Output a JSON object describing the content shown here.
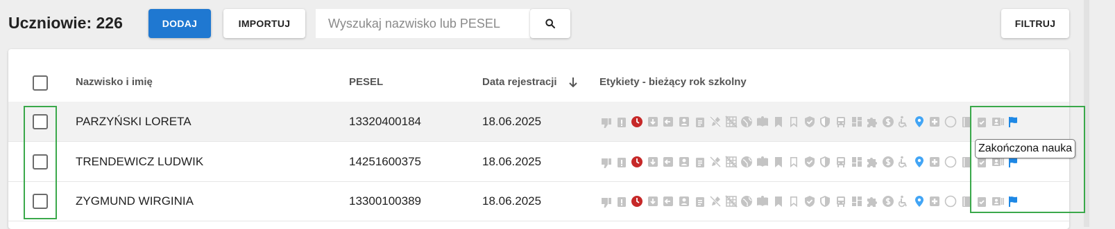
{
  "header": {
    "title": "Uczniowie: 226",
    "add_label": "DODAJ",
    "import_label": "IMPORTUJ",
    "search_placeholder": "Wyszukaj nazwisko lub PESEL",
    "filter_label": "FILTRUJ"
  },
  "table": {
    "columns": {
      "name": "Nazwisko i imię",
      "pesel": "PESEL",
      "date": "Data rejestracji",
      "labels": "Etykiety - bieżący rok szkolny"
    },
    "sort": {
      "column": "date",
      "direction": "desc"
    },
    "rows": [
      {
        "name": "PARZYŃSKI LORETA",
        "pesel": "13320400184",
        "date": "18.06.2025"
      },
      {
        "name": "TRENDEWICZ LUDWIK",
        "pesel": "14251600375",
        "date": "18.06.2025"
      },
      {
        "name": "ZYGMUND WIRGINIA",
        "pesel": "13300100389",
        "date": "18.06.2025"
      }
    ]
  },
  "label_icons": [
    "thumb-down-icon",
    "clipboard-alert-icon",
    "clock-icon",
    "download-box-icon",
    "back-box-icon",
    "account-box-icon",
    "clipboard-text-icon",
    "pen-off-icon",
    "grid-off-icon",
    "globe-icon",
    "book-open-icon",
    "bookmark-icon",
    "bookmark-outline-icon",
    "shield-check-icon",
    "shield-half-icon",
    "bus-icon",
    "view-dashboard-icon",
    "puzzle-icon",
    "dollar-circle-icon",
    "wheelchair-icon",
    "map-marker-icon",
    "plus-box-icon",
    "circle-outline-icon",
    "notebook-icon",
    "clipboard-check-icon",
    "contact-card-icon",
    "flag-icon"
  ],
  "tooltip": "Zakończona nauka",
  "colors": {
    "primary": "#1f78d1",
    "icon_gray": "#c4c4c4",
    "clock_red": "#c62828",
    "marker_blue": "#42a5f5",
    "flag_blue": "#1e88e5",
    "highlight_green": "#3aa84a"
  }
}
